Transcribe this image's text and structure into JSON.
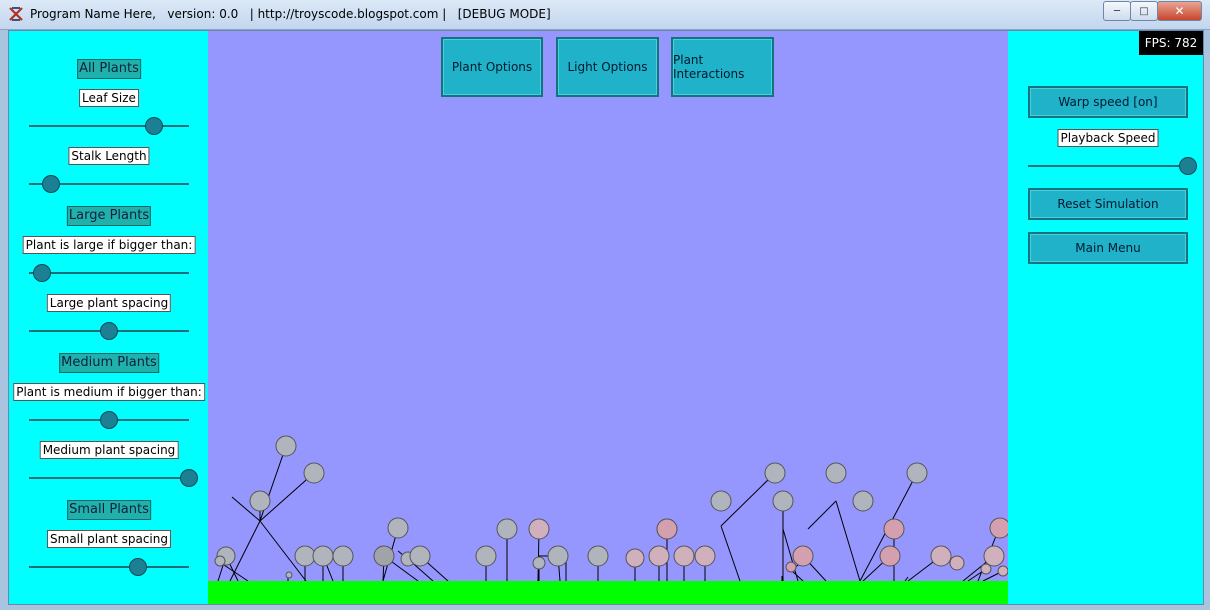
{
  "window": {
    "title": "Program Name Here,   version: 0.0   | http://troyscode.blogspot.com |   [DEBUG MODE]",
    "minimize": "─",
    "maximize": "□",
    "close": "✕"
  },
  "left_panel": {
    "all_plants": "All Plants",
    "leaf_size": {
      "label": "Leaf Size",
      "value": 0.78
    },
    "stalk_length": {
      "label": "Stalk Length",
      "value": 0.14
    },
    "large_plants": "Large Plants",
    "large_threshold": {
      "label": "Plant is large if bigger than:",
      "value": 0.08
    },
    "large_spacing": {
      "label": "Large plant spacing",
      "value": 0.5
    },
    "medium_plants": "Medium Plants",
    "medium_threshold": {
      "label": "Plant is medium if bigger than:",
      "value": 0.5
    },
    "medium_spacing": {
      "label": "Medium plant spacing",
      "value": 1.0
    },
    "small_plants": "Small Plants",
    "small_spacing": {
      "label": "Small plant spacing",
      "value": 0.68
    }
  },
  "top_buttons": {
    "plant_options": "Plant Options",
    "light_options": "Light Options",
    "plant_interactions": "Plant Interactions"
  },
  "right_panel": {
    "fps": "FPS: 782",
    "warp_speed": "Warp speed [on]",
    "playback_speed": {
      "label": "Playback Speed",
      "value": 1.0
    },
    "reset_simulation": "Reset Simulation",
    "main_menu": "Main Menu"
  },
  "colors": {
    "panel": "#00ffff",
    "sim_bg": "#9696ff",
    "ground": "#00ff00",
    "leaf_gray": "#b0b4bc",
    "leaf_pink": "#d4a0b0"
  }
}
